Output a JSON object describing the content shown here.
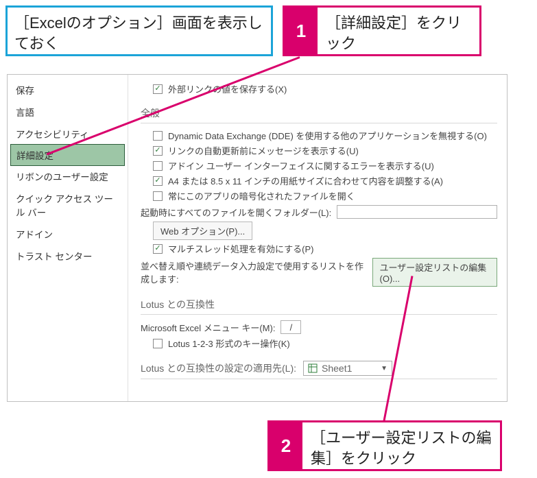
{
  "callouts": {
    "blue": "［Excelのオプション］画面を表示しておく",
    "pink1_num": "1",
    "pink1_text": "［詳細設定］をクリック",
    "pink2_num": "2",
    "pink2_text": "［ユーザー設定リストの編集］をクリック"
  },
  "sidebar": {
    "items": [
      {
        "label": "保存"
      },
      {
        "label": "言語"
      },
      {
        "label": "アクセシビリティ"
      },
      {
        "label": "詳細設定",
        "selected": true
      },
      {
        "label": "リボンのユーザー設定"
      },
      {
        "label": "クイック アクセス ツール バー"
      },
      {
        "label": "アドイン"
      },
      {
        "label": "トラスト センター"
      }
    ]
  },
  "main": {
    "ext_link": "外部リンクの値を保存する(X)",
    "section_general": "全般",
    "opts": {
      "dde": "Dynamic Data Exchange (DDE) を使用する他のアプリケーションを無視する(O)",
      "autoupdate": "リンクの自動更新前にメッセージを表示する(U)",
      "addin_err": "アドイン ユーザー インターフェイスに関するエラーを表示する(U)",
      "paper": "A4 または 8.5 x 11 インチの用紙サイズに合わせて内容を調整する(A)",
      "encrypted": "常にこのアプリの暗号化されたファイルを開く",
      "startup_label": "起動時にすべてのファイルを開くフォルダー(L):",
      "web_opt_btn": "Web オプション(P)...",
      "multithread": "マルチスレッド処理を有効にする(P)",
      "sort_label": "並べ替え順や連続データ入力設定で使用するリストを作成します:",
      "edit_list_btn": "ユーザー設定リストの編集(O)..."
    },
    "section_lotus1": "Lotus との互換性",
    "lotus": {
      "menu_key_label": "Microsoft Excel メニュー キー(M):",
      "menu_key_value": "/",
      "lotus123": "Lotus 1-2-3 形式のキー操作(K)"
    },
    "section_lotus2": "Lotus との互換性の設定の適用先(L):",
    "sheet_select": "Sheet1"
  }
}
